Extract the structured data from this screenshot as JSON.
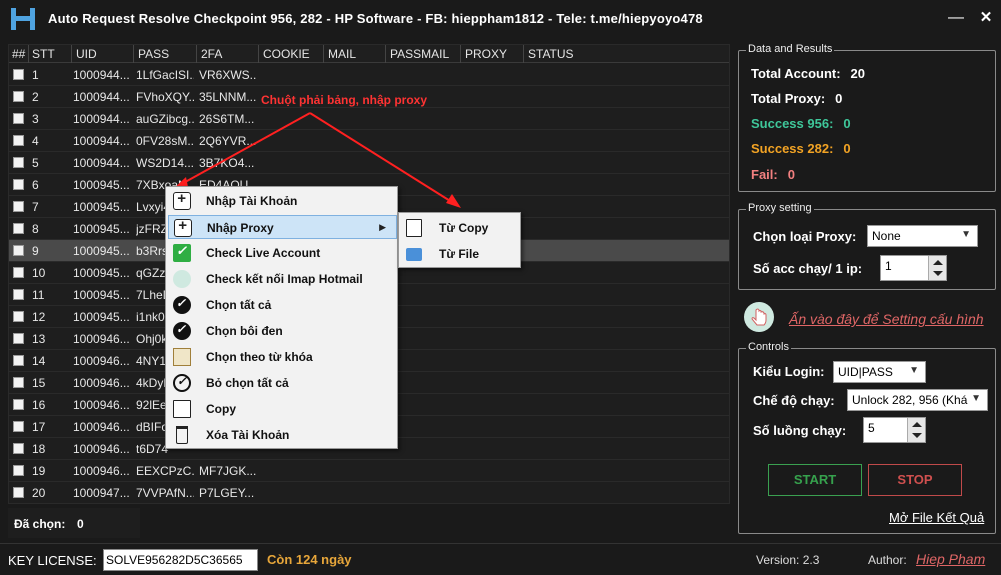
{
  "window": {
    "title": "Auto Request Resolve Checkpoint 956, 282 - HP Software - FB: hieppham1812 - Tele: t.me/hiepyoyo478",
    "minimize": "—",
    "close": "✕"
  },
  "grid": {
    "columns": [
      "##",
      "STT",
      "UID",
      "PASS",
      "2FA",
      "COOKIE",
      "MAIL",
      "PASSMAIL",
      "PROXY",
      "STATUS"
    ],
    "rows": [
      {
        "stt": "1",
        "uid": "1000944...",
        "pass": "1LfGacISI...",
        "fa": "VR6XWS..."
      },
      {
        "stt": "2",
        "uid": "1000944...",
        "pass": "FVhoXQY...",
        "fa": "35LNNM..."
      },
      {
        "stt": "3",
        "uid": "1000944...",
        "pass": "auGZibcg...",
        "fa": "26S6TM..."
      },
      {
        "stt": "4",
        "uid": "1000944...",
        "pass": "0FV28sM...",
        "fa": "2Q6YVR..."
      },
      {
        "stt": "5",
        "uid": "1000944...",
        "pass": "WS2D14...",
        "fa": "3B7KO4..."
      },
      {
        "stt": "6",
        "uid": "1000945...",
        "pass": "7XBxoaM...",
        "fa": "ED4AOU..."
      },
      {
        "stt": "7",
        "uid": "1000945...",
        "pass": "Lvxyi4",
        "fa": ""
      },
      {
        "stt": "8",
        "uid": "1000945...",
        "pass": "jzFRZ",
        "fa": ""
      },
      {
        "stt": "9",
        "uid": "1000945...",
        "pass": "b3Rrsu",
        "fa": ""
      },
      {
        "stt": "10",
        "uid": "1000945...",
        "pass": "qGZzc",
        "fa": ""
      },
      {
        "stt": "11",
        "uid": "1000945...",
        "pass": "7LheD",
        "fa": ""
      },
      {
        "stt": "12",
        "uid": "1000945...",
        "pass": "i1nk03",
        "fa": ""
      },
      {
        "stt": "13",
        "uid": "1000946...",
        "pass": "Ohj0k",
        "fa": ""
      },
      {
        "stt": "14",
        "uid": "1000946...",
        "pass": "4NY1l",
        "fa": ""
      },
      {
        "stt": "15",
        "uid": "1000946...",
        "pass": "4kDyL",
        "fa": ""
      },
      {
        "stt": "16",
        "uid": "1000946...",
        "pass": "92lEe",
        "fa": ""
      },
      {
        "stt": "17",
        "uid": "1000946...",
        "pass": "dBIFoj",
        "fa": ""
      },
      {
        "stt": "18",
        "uid": "1000946...",
        "pass": "t6D74",
        "fa": ""
      },
      {
        "stt": "19",
        "uid": "1000946...",
        "pass": "EEXCPzC...",
        "fa": "MF7JGK..."
      },
      {
        "stt": "20",
        "uid": "1000947...",
        "pass": "7VVPAfN...",
        "fa": "P7LGEY..."
      }
    ],
    "selected_label": "Đã chọn:",
    "selected_count": "0"
  },
  "annotation": "Chuột phải bảng, nhập proxy",
  "context_menu": {
    "items": [
      {
        "label": "Nhập Tài Khoản",
        "icon": "plus-box-icon"
      },
      {
        "label": "Nhập Proxy",
        "icon": "plus-box-icon",
        "submenu": "▶"
      },
      {
        "label": "Check Live Account",
        "icon": "green-check-icon"
      },
      {
        "label": "Check kết nối Imap Hotmail",
        "icon": "hand-icon"
      },
      {
        "label": "Chọn tất cả",
        "icon": "check-circle-icon"
      },
      {
        "label": "Chọn bôi đen",
        "icon": "check-circle-icon"
      },
      {
        "label": "Chọn theo từ khóa",
        "icon": "keyword-icon"
      },
      {
        "label": "Bỏ chọn tất cả",
        "icon": "check-circle-outline-icon"
      },
      {
        "label": "Copy",
        "icon": "copy-icon"
      },
      {
        "label": "Xóa Tài Khoản",
        "icon": "trash-icon"
      }
    ],
    "submenu": [
      {
        "label": "Từ Copy",
        "icon": "copy-icon"
      },
      {
        "label": "Từ File",
        "icon": "folder-icon"
      }
    ]
  },
  "data_results": {
    "title": "Data and Results",
    "total_account_label": "Total Account:",
    "total_account": "20",
    "total_proxy_label": "Total Proxy:",
    "total_proxy": "0",
    "success956_label": "Success 956:",
    "success956": "0",
    "success282_label": "Success 282:",
    "success282": "0",
    "fail_label": "Fail:",
    "fail": "0",
    "colors": {
      "default": "#ffffff",
      "success956": "#3fc79a",
      "success282": "#f2a324",
      "fail": "#f28080"
    }
  },
  "proxy_setting": {
    "title": "Proxy setting",
    "type_label": "Chọn loại Proxy:",
    "type_value": "None",
    "acc_per_ip_label": "Số acc chạy/ 1 ip:",
    "acc_per_ip": "1"
  },
  "settings_link": "Ấn vào đây để Setting cấu hình",
  "controls": {
    "title": "Controls",
    "login_type_label": "Kiểu Login:",
    "login_type": "UID|PASS",
    "run_mode_label": "Chế độ chạy:",
    "run_mode": "Unlock 282, 956 (Khá",
    "threads_label": "Số luồng chạy:",
    "threads": "5",
    "start": "START",
    "stop": "STOP",
    "open_result": "Mở File Kết Quả"
  },
  "license": {
    "label": "KEY LICENSE:",
    "value": "SOLVE956282D5C36565",
    "days": "Còn 124 ngày",
    "version": "Version: 2.3",
    "author_label": "Author:",
    "author": "Hiep Pham"
  }
}
